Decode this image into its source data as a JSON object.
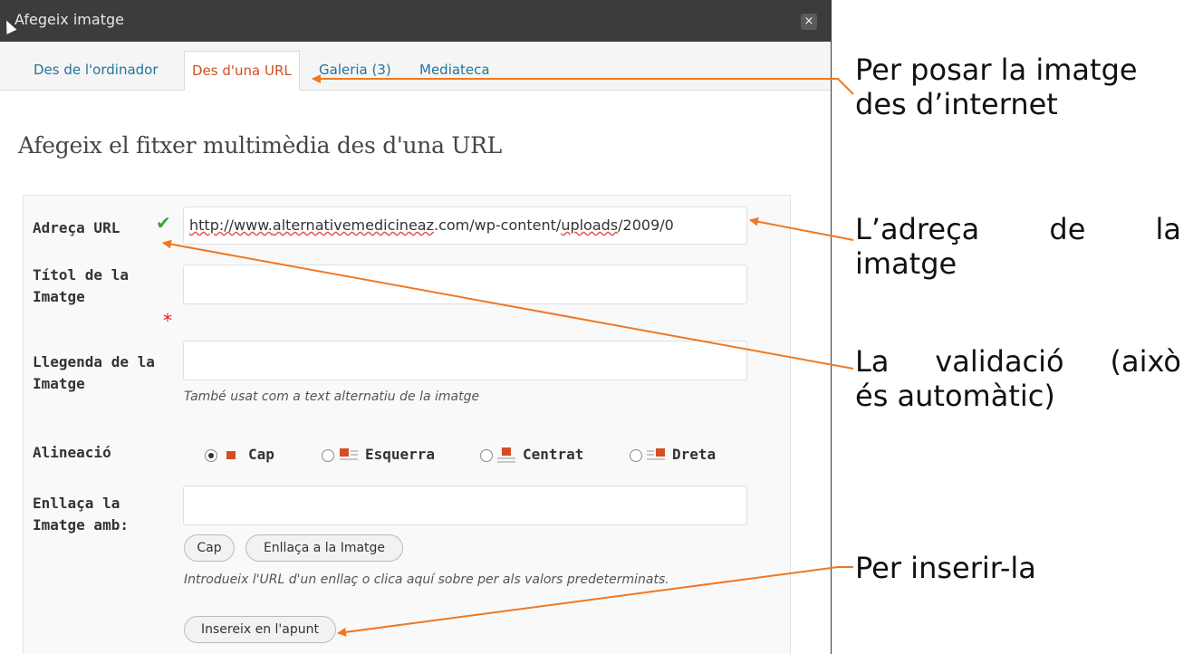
{
  "dialog": {
    "title": "Afegeix imatge",
    "close_label": "×"
  },
  "tabs": [
    {
      "label": "Des de l'ordinador",
      "active": false
    },
    {
      "label": "Des d'una URL",
      "active": true
    },
    {
      "label": "Galeria (3)",
      "active": false
    },
    {
      "label": "Mediateca",
      "active": false
    }
  ],
  "heading": "Afegeix el fitxer multimèdia des d'una URL",
  "form": {
    "url_label": "Adreça URL",
    "url_value_prefix": "http://www.",
    "url_value_mid": "alternativemedicineaz",
    "url_value_mid2": ".com/wp-content/",
    "url_value_mid3": "uploads",
    "url_value_suffix": "/2009/0",
    "check_glyph": "✔",
    "title_label_line1": "Títol de la",
    "title_label_line2": "Imatge",
    "required_mark": "*",
    "caption_label_line1": "Llegenda de la",
    "caption_label_line2": "Imatge",
    "caption_help": "També usat com a text alternatiu de la imatge",
    "align_label": "Alineació",
    "align_options": [
      "Cap",
      "Esquerra",
      "Centrat",
      "Dreta"
    ],
    "align_selected": "Cap",
    "link_label_line1": "Enllaça la",
    "link_label_line2": "Imatge amb:",
    "link_btn_none": "Cap",
    "link_btn_image": "Enllaça a la Imatge",
    "link_help": "Introdueix l'URL d'un enllaç o clica aquí sobre per als valors predeterminats.",
    "insert_button": "Insereix en l'apunt"
  },
  "annotations": {
    "tab_note_line1": "Per posar la imatge",
    "tab_note_line2": "des d’internet",
    "url_note_w1": "L’adreça",
    "url_note_w2": "de",
    "url_note_w3": "la",
    "url_note_line2": "imatge",
    "valid_note_w1": "La",
    "valid_note_w2": "validació",
    "valid_note_w3": "(això",
    "valid_note_line2": "és automàtic)",
    "insert_note": "Per inserir-la",
    "arrow_color": "#f07820"
  }
}
